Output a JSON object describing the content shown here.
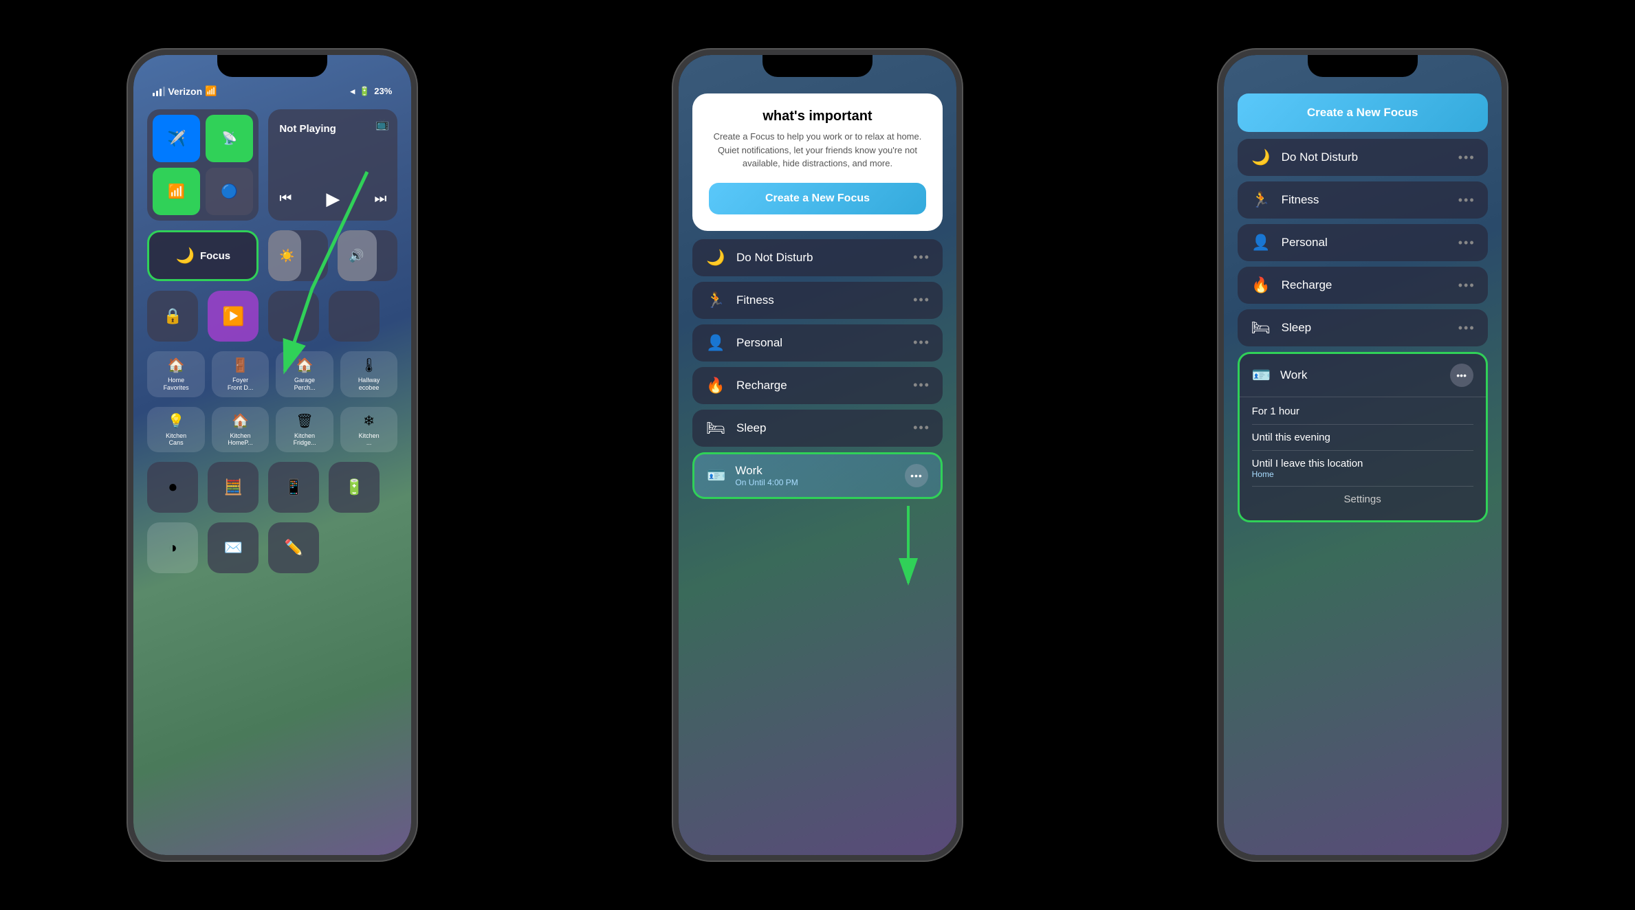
{
  "phone1": {
    "status": {
      "carrier": "Verizon",
      "battery_pct": "23%",
      "battery_label": "23%"
    },
    "widgets": {
      "airplane_label": "✈",
      "wifi_label": "📶",
      "bluetooth_label": "bluetooth",
      "cellular_label": "cellular",
      "now_playing_label": "Not Playing",
      "focus_label": "Focus",
      "brightness_label": "☀",
      "volume_label": "🔊",
      "home_label": "Home\nFavorites",
      "foyer_label": "Foyer\nFront D...",
      "garage_label": "Garage\nPerch...",
      "hallway_label": "Hallway\necobee",
      "kitchen_cans_label": "Kitchen\nCans",
      "kitchen_homep_label": "Kitchen\nHomeP...",
      "kitchen_fridge_label": "Kitchen\nFridge..."
    }
  },
  "phone2": {
    "card": {
      "title": "what's important",
      "description": "Create a Focus to help you work or to relax at home. Quiet notifications, let your friends know you're not available, hide distractions, and more.",
      "btn_label": "Create a New Focus"
    },
    "items": [
      {
        "icon": "🌙",
        "name": "Do Not Disturb"
      },
      {
        "icon": "🏃",
        "name": "Fitness"
      },
      {
        "icon": "👤",
        "name": "Personal"
      },
      {
        "icon": "🔥",
        "name": "Recharge"
      },
      {
        "icon": "🛏",
        "name": "Sleep"
      }
    ],
    "work_item": {
      "icon": "🪪",
      "name": "Work",
      "subtitle": "On Until 4:00 PM"
    }
  },
  "phone3": {
    "create_btn": "Create a New Focus",
    "items": [
      {
        "icon": "🌙",
        "name": "Do Not Disturb"
      },
      {
        "icon": "🏃",
        "name": "Fitness"
      },
      {
        "icon": "👤",
        "name": "Personal"
      },
      {
        "icon": "🔥",
        "name": "Recharge"
      },
      {
        "icon": "🛏",
        "name": "Sleep"
      }
    ],
    "work_expanded": {
      "icon": "🪪",
      "name": "Work",
      "option1": "For 1 hour",
      "option2": "Until this evening",
      "option3": "Until I leave this location",
      "option3_sub": "Home",
      "settings": "Settings"
    }
  }
}
